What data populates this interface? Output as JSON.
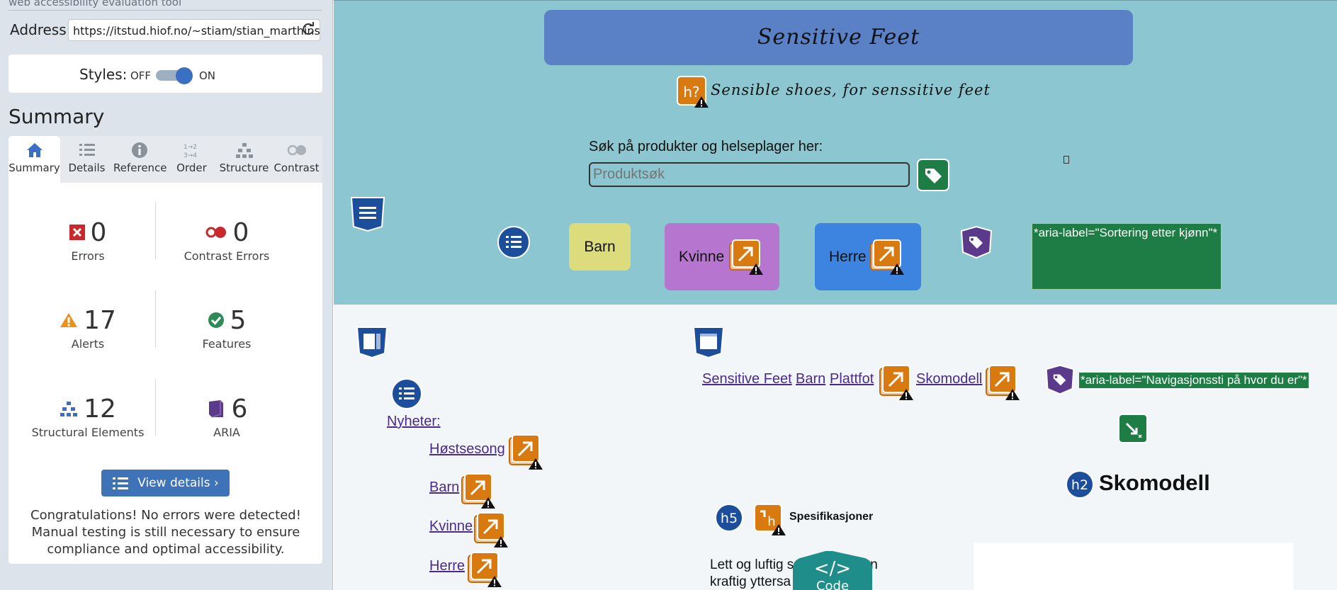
{
  "sidebar": {
    "brand_subtitle": "web accessibility evaluation tool",
    "address_label": "Address:",
    "address_value": "https://itstud.hiof.no/~stiam/stian_marthinsen",
    "styles_label": "Styles:",
    "styles_off": "OFF",
    "styles_on": "ON",
    "summary_title": "Summary",
    "tabs": [
      {
        "label": "Summary",
        "icon": "home-icon"
      },
      {
        "label": "Details",
        "icon": "list-icon"
      },
      {
        "label": "Reference",
        "icon": "info-icon"
      },
      {
        "label": "Order",
        "icon": "order-icon"
      },
      {
        "label": "Structure",
        "icon": "structure-icon"
      },
      {
        "label": "Contrast",
        "icon": "contrast-icon"
      }
    ],
    "stats": {
      "errors": {
        "count": "0",
        "label": "Errors"
      },
      "contrast_errors": {
        "count": "0",
        "label": "Contrast Errors"
      },
      "alerts": {
        "count": "17",
        "label": "Alerts"
      },
      "features": {
        "count": "5",
        "label": "Features"
      },
      "structural": {
        "count": "12",
        "label": "Structural Elements"
      },
      "aria": {
        "count": "6",
        "label": "ARIA"
      }
    },
    "view_details": "View details ›",
    "congrats": "Congratulations! No errors were detected! Manual testing is still necessary to ensure compliance and optimal accessibility."
  },
  "page": {
    "site_title": "Sensitive Feet",
    "subtitle": "Sensible shoes, for senssitive feet",
    "search_label": "Søk på produkter og helseplager her:",
    "search_placeholder": "Produktsøk",
    "nav": {
      "barn": "Barn",
      "kvinne": "Kvinne",
      "herre": "Herre"
    },
    "aria_sort": "*aria-label=\"Sortering etter kjønn\"*",
    "aria_breadcrumb": "*aria-label=\"Navigasjonssti på hvor du er\"*",
    "breadcrumb": [
      "Sensitive Feet",
      "Barn",
      "Plattfot",
      "Skomodell"
    ],
    "news_heading": "Nyheter:",
    "news_links": [
      "Høstsesong",
      "Barn",
      "Kvinne",
      "Herre"
    ],
    "h2_badge": "h2",
    "h5_badge": "h5",
    "product_heading": "Skomodell",
    "spec_heading": "Spesifikasjoner",
    "para_line1": "Lett og luftig s",
    "para_line1_end": "n",
    "para_line2": "kraftig yttersa",
    "code_label": "Code",
    "code_glyph": "</>",
    "h_badge_q": "h?"
  },
  "colors": {
    "header_bg": "#8cc6d1",
    "title_bg": "#5a80c5",
    "barn_bg": "#dcdc7c",
    "kvinne_bg": "#b676d0",
    "herre_bg": "#3d84e0",
    "aria_green": "#1e7d45",
    "alert_orange": "#d97a10",
    "structure_blue": "#1d4e9c",
    "aria_purple": "#5b3a8c"
  }
}
